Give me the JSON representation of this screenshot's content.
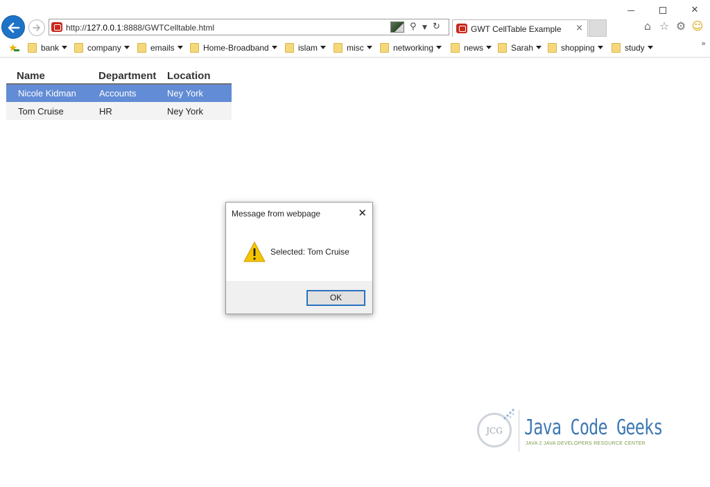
{
  "browser": {
    "url_prefix": "http://",
    "url_host": "127.0.0.1",
    "url_rest": ":8888/GWTCelltable.html",
    "tab_title": "GWT CellTable Example",
    "tab_close": "×"
  },
  "window_controls": {
    "close": "✕"
  },
  "favorites": [
    {
      "label": "bank"
    },
    {
      "label": "company"
    },
    {
      "label": "emails"
    },
    {
      "label": "Home-Broadband"
    },
    {
      "label": "islam"
    },
    {
      "label": "misc"
    },
    {
      "label": "networking"
    },
    {
      "label": "news"
    },
    {
      "label": "Sarah"
    },
    {
      "label": "shopping"
    },
    {
      "label": "study"
    }
  ],
  "favorites_more": "»",
  "table": {
    "headers": [
      "Name",
      "Department",
      "Location"
    ],
    "rows": [
      {
        "name": "Nicole Kidman",
        "department": "Accounts",
        "location": "Ney York",
        "selected": true
      },
      {
        "name": "Tom Cruise",
        "department": "HR",
        "location": "Ney York",
        "selected": false
      }
    ]
  },
  "dialog": {
    "title": "Message from webpage",
    "message": "Selected: Tom Cruise",
    "ok_label": "OK",
    "close": "✕"
  },
  "watermark": {
    "circle_text": "JCG",
    "title": "Java Code Geeks",
    "subtitle": "JAVA 2 JAVA DEVELOPERS RESOURCE CENTER"
  },
  "colors": {
    "accent": "#1e73c8",
    "selected_row": "#628cd5",
    "warning": "#f5c400"
  }
}
